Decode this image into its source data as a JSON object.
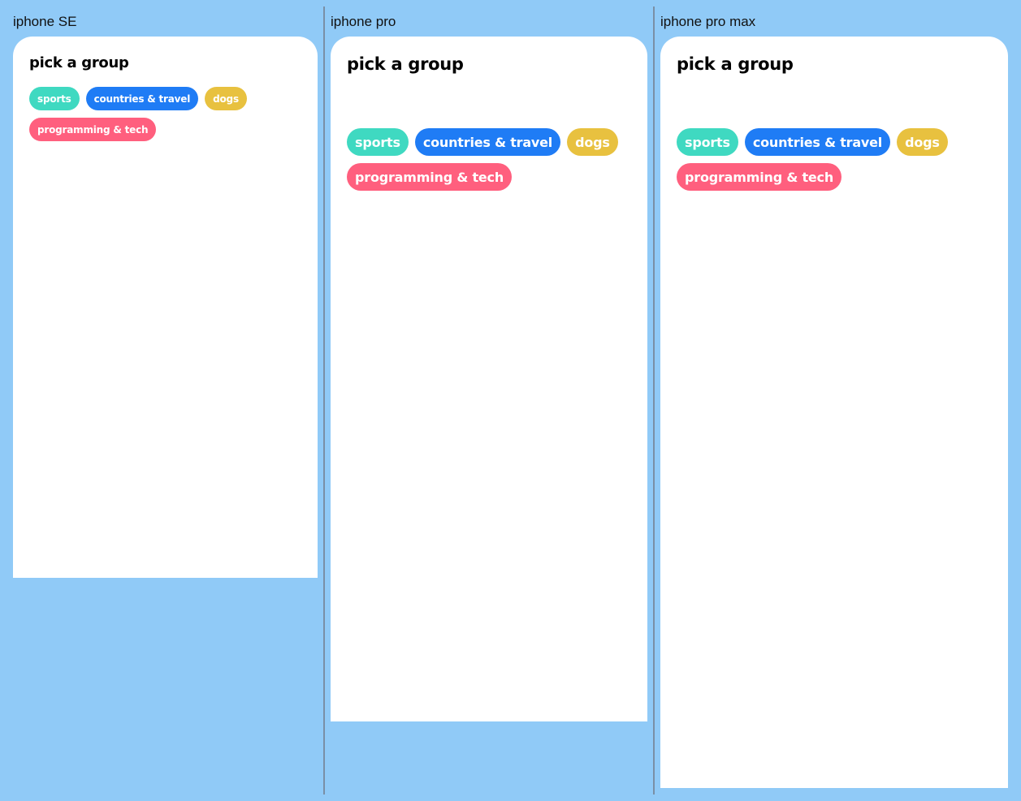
{
  "devices": [
    {
      "label": "iphone SE"
    },
    {
      "label": "iphone pro"
    },
    {
      "label": "iphone pro max"
    }
  ],
  "screen": {
    "title": "pick a group",
    "groups": [
      {
        "label": "sports",
        "color": "#3fd9c1"
      },
      {
        "label": "countries & travel",
        "color": "#1f7cf5"
      },
      {
        "label": "dogs",
        "color": "#e8c13f"
      },
      {
        "label": "programming & tech",
        "color": "#ff5f7e"
      }
    ]
  },
  "colors": {
    "background": "#90caf7",
    "card": "#ffffff"
  }
}
